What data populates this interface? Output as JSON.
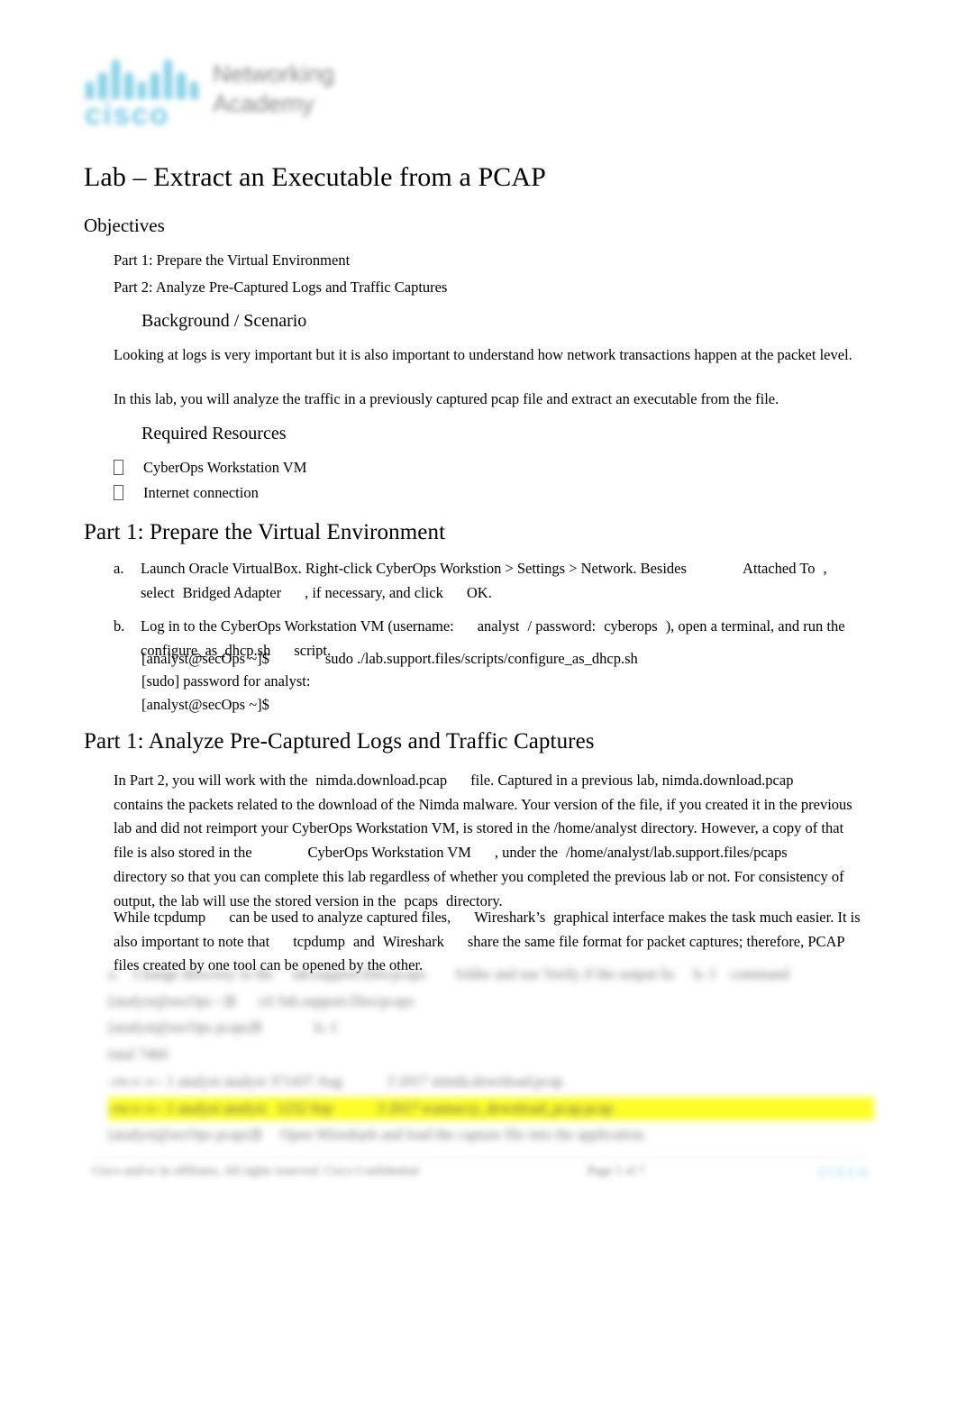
{
  "header": {
    "logo_name": "cisco",
    "brand_line1": "Networking",
    "brand_line2": "Academy",
    "logo_color": "#7ecde4"
  },
  "document": {
    "title": "Lab – Extract an Executable from a PCAP"
  },
  "objectives": {
    "heading": "Objectives",
    "items": [
      "Part 1: Prepare the Virtual Environment",
      "Part 2: Analyze Pre-Captured Logs and Traffic Captures"
    ]
  },
  "background": {
    "heading": "Background / Scenario",
    "paragraph1": "Looking at logs is very important but it is also important to understand how network transactions happen at the packet level.",
    "paragraph2": "In this lab, you will analyze the traffic in a previously captured pcap file and extract an executable from the file."
  },
  "required_resources": {
    "heading": "Required Resources",
    "items": [
      "CyberOps Workstation VM",
      "Internet connection"
    ],
    "bullet_glyph": "tofu-box"
  },
  "part1": {
    "heading": "Part 1: Prepare the Virtual Environment",
    "steps": [
      {
        "marker": "a.",
        "text_1": "Launch Oracle VirtualBox. Right-click CyberOps Workstion > Settings > Network. Besides",
        "bold_1": "Attached To",
        "text_2": ",",
        "text_3": "select",
        "bold_2": "Bridged Adapter",
        "text_4": ", if necessary, and click",
        "bold_3": "OK.",
        "text_5": ""
      },
      {
        "marker": "b.",
        "text_1": "Log in to the CyberOps Workstation VM (username:",
        "bold_1": "analyst",
        "text_2": "/ password:",
        "bold_2": "cyberops",
        "text_3": "), open a terminal, and run the",
        "bold_3": "configure_as_dhcp.sh",
        "text_4": "script."
      }
    ],
    "terminal": {
      "line1_prompt": "[analyst@secOps ~]$",
      "line1_command": "sudo ./lab.support.files/scripts/configure_as_dhcp.sh",
      "line2": "[sudo] password for analyst:",
      "line3": "[analyst@secOps ~]$"
    }
  },
  "part2": {
    "heading": "Part 1: Analyze Pre-Captured Logs and Traffic Captures",
    "intro": {
      "seg1": "In Part 2, you will work with the",
      "bold1": "nimda.download.pcap",
      "seg2": "file. Captured in a previous lab,",
      "bold2": "nimda.download.pcap",
      "seg3": "contains the packets related to the download of the Nimda malware. Your version of the file, if you created it in the previous lab and did not reimport your CyberOps Workstation VM, is stored in the /home/analyst directory. However, a copy of that file is also stored in the",
      "bold3": "CyberOps Workstation VM",
      "seg4": ", under the",
      "bold4": "/home/analyst/lab.support.files/pcaps",
      "seg5": "directory so that you can complete this lab regardless of whether you completed the previous lab or not. For consistency of output, the lab will use the stored version in the",
      "bold5": "pcaps",
      "seg6": "directory."
    },
    "tcpdump_note": {
      "seg1": "While tcpdump",
      "seg2": "can be used to analyze captured files,",
      "bold1": "Wireshark’s",
      "seg3": "graphical interface makes the task much easier. It is also important to note that",
      "bold2": "tcpdump",
      "seg4": "and",
      "bold3": "Wireshark",
      "seg5": "share the same file format for packet captures; therefore, PCAP files created by one tool can be opened by the other."
    }
  },
  "redacted_block": {
    "note": "blurred / unreadable region",
    "highlight_color": "#fdfd19",
    "lines": [
      "a.    Change directory to the     lab.support.files/pcaps        folder and use Verify if the output lis     ls -l    command",
      "[analyst@secOps ~]$      cd /lab.support.files/pcaps",
      "[analyst@secOps pcaps]$              ls -l",
      "total 7460",
      "-rw-r--r-- 1 analyst analyst 371437 Aug            3 2017 nimda.download.pcap",
      "-rw-r--r-- 1 analyst analyst   1232 Sep            3 2017 wannacry_download_pcap.pcap",
      "[analyst@secOps pcaps]$     Open Wireshark and load the capture file into the application."
    ]
  },
  "footer": {
    "copyright": "Cisco and/or its affiliates. All rights reserved. Cisco Confidential",
    "page": "Page   1 of 7",
    "logo": "cisco"
  }
}
